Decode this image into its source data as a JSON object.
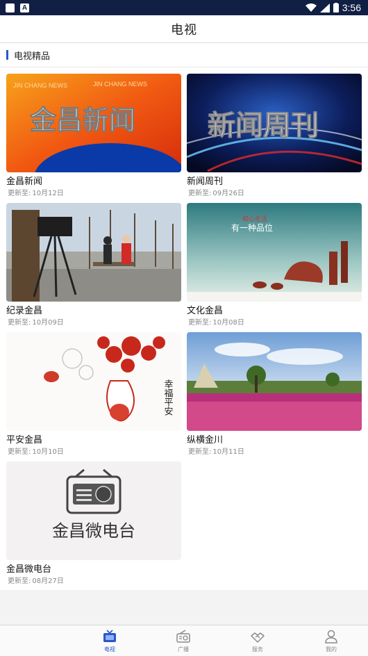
{
  "status_bar": {
    "time": "3:56"
  },
  "header": {
    "title": "电视"
  },
  "section": {
    "title": "电视精品"
  },
  "programs": [
    {
      "name": "金昌新闻",
      "date_prefix": "更新至:",
      "date": "10月12日",
      "art_text": "金昌新闻",
      "art_sub": "JIN CHANG NEWS"
    },
    {
      "name": "新闻周刊",
      "date_prefix": "更新至:",
      "date": "09月26日",
      "art_text": "新闻周刊"
    },
    {
      "name": "纪录金昌",
      "date_prefix": "更新至:",
      "date": "10月09日"
    },
    {
      "name": "文化金昌",
      "date_prefix": "更新至:",
      "date": "10月08日",
      "art_text": "有一种品位",
      "art_stamp": "和心生活"
    },
    {
      "name": "平安金昌",
      "date_prefix": "更新至:",
      "date": "10月10日",
      "art_text": "幸福平安"
    },
    {
      "name": "纵横金川",
      "date_prefix": "更新至:",
      "date": "10月11日"
    },
    {
      "name": "金昌微电台",
      "date_prefix": "更新至:",
      "date": "08月27日",
      "art_text": "金昌微电台"
    }
  ],
  "tabs": [
    {
      "label": "电视",
      "icon": "tv-icon",
      "active": true
    },
    {
      "label": "广播",
      "icon": "radio-icon",
      "active": false
    },
    {
      "label": "服务",
      "icon": "handshake-icon",
      "active": false
    },
    {
      "label": "我的",
      "icon": "person-icon",
      "active": false
    }
  ],
  "colors": {
    "status_bar": "#121f44",
    "accent": "#2a56c6",
    "muted_text": "#888888"
  }
}
